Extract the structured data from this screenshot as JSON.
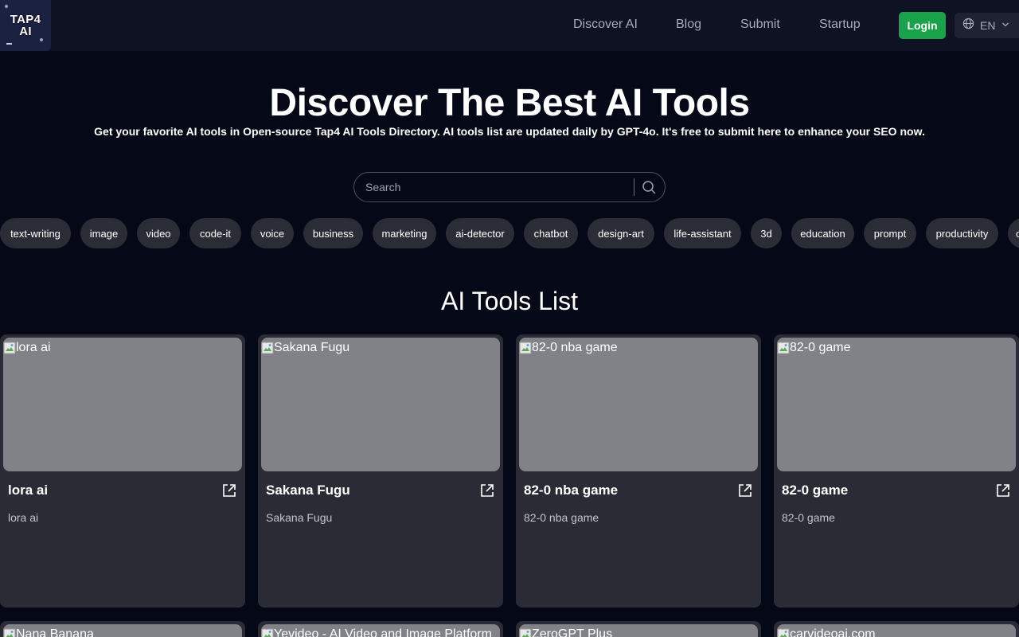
{
  "header": {
    "logo_line1": "TAP4",
    "logo_line2": "AI",
    "nav": [
      {
        "label": "Discover AI"
      },
      {
        "label": "Blog"
      },
      {
        "label": "Submit"
      },
      {
        "label": "Startup"
      }
    ],
    "login_label": "Login",
    "language": "EN",
    "colors": {
      "header_bg": "#0e1223",
      "login_bg": "#18a34a"
    }
  },
  "hero": {
    "title": "Discover The Best AI Tools",
    "subtitle": "Get your favorite AI tools in Open-source Tap4 AI Tools Directory. AI tools list are updated daily by GPT-4o. It's free to submit here to enhance your SEO now."
  },
  "search": {
    "placeholder": "Search",
    "value": "",
    "icon": "search-icon"
  },
  "tags": [
    "text-writing",
    "image",
    "video",
    "code-it",
    "voice",
    "business",
    "marketing",
    "ai-detector",
    "chatbot",
    "design-art",
    "life-assistant",
    "3d",
    "education",
    "prompt",
    "productivity",
    "o"
  ],
  "list": {
    "title": "AI Tools List",
    "cards": [
      {
        "image_alt": "lora ai",
        "title": "lora ai",
        "description": "lora ai"
      },
      {
        "image_alt": "Sakana Fugu",
        "title": "Sakana Fugu",
        "description": "Sakana Fugu"
      },
      {
        "image_alt": "82-0 nba game",
        "title": "82-0 nba game",
        "description": "82-0 nba game"
      },
      {
        "image_alt": "82-0 game",
        "title": "82-0 game",
        "description": "82-0 game"
      },
      {
        "image_alt": "Nana Banana",
        "title": "",
        "description": ""
      },
      {
        "image_alt": "Yevideo - AI Video and Image Platform",
        "title": "",
        "description": ""
      },
      {
        "image_alt": "ZeroGPT Plus",
        "title": "",
        "description": ""
      },
      {
        "image_alt": "carvideoai.com",
        "title": "",
        "description": ""
      }
    ],
    "colors": {
      "card_bg": "#2a2b35",
      "image_placeholder": "#818288"
    }
  }
}
